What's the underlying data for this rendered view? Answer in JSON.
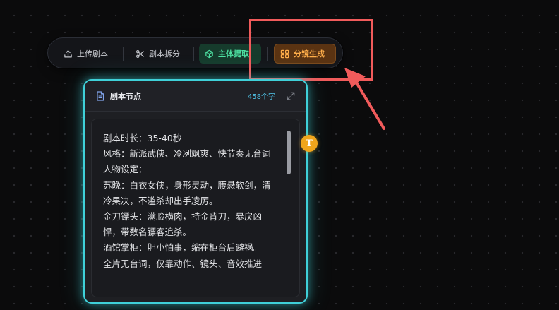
{
  "toolbar": {
    "upload_label": "上传剧本",
    "split_label": "剧本拆分",
    "extract_label": "主体提取",
    "storyboard_label": "分镜生成"
  },
  "node": {
    "title": "剧本节点",
    "char_count": "458个字",
    "content": "剧本时长：35-40秒\n风格：新派武侠、冷冽飒爽、快节奏无台词\n人物设定：\n苏晚：白衣女侠，身形灵动，腰悬软剑，清冷果决，不滥杀却出手凌厉。\n金刀镖头：满脸横肉，持金背刀，暴戾凶悍，带数名镖客追杀。\n酒馆掌柜：胆小怕事，缩在柜台后避祸。\n全片无台词，仅靠动作、镜头、音效推进"
  },
  "handle": {
    "label": "T"
  },
  "colors": {
    "node_border": "#3fd0d8",
    "extract_text": "#4ee2a3",
    "storyboard_text": "#ffae4a",
    "annotation_red": "#f15b5b",
    "handle_orange": "#f0a51c"
  },
  "icons": {
    "upload": "upload-icon",
    "split": "scissors-icon",
    "extract": "cube-icon",
    "storyboard": "grid-icon",
    "document": "document-icon",
    "expand": "expand-icon"
  }
}
